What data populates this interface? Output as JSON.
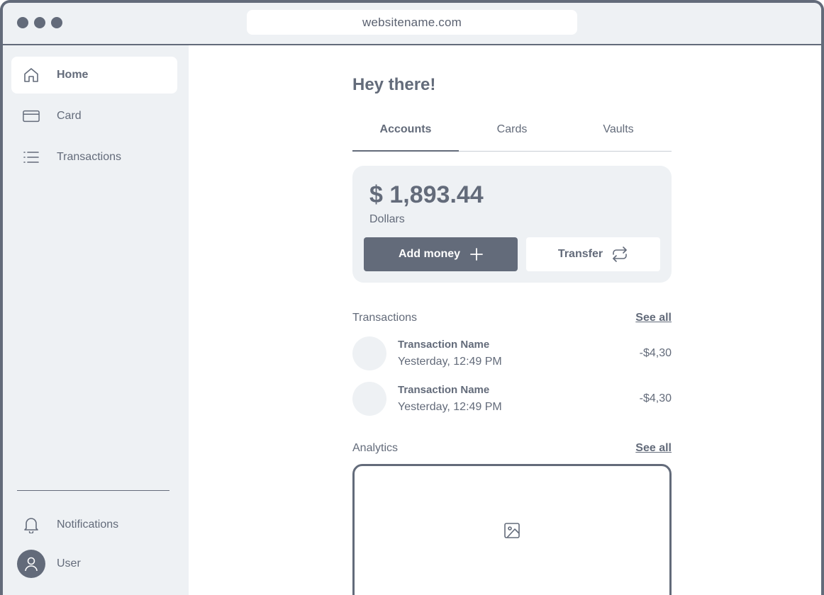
{
  "browser": {
    "url": "websitename.com"
  },
  "sidebar": {
    "items": [
      {
        "label": "Home",
        "icon": "home-icon",
        "active": true
      },
      {
        "label": "Card",
        "icon": "card-icon",
        "active": false
      },
      {
        "label": "Transactions",
        "icon": "list-icon",
        "active": false
      }
    ],
    "bottom": {
      "notifications_label": "Notifications",
      "user_label": "User"
    }
  },
  "main": {
    "greeting": "Hey there!",
    "tabs": [
      {
        "label": "Accounts",
        "active": true
      },
      {
        "label": "Cards",
        "active": false
      },
      {
        "label": "Vaults",
        "active": false
      }
    ],
    "balance": {
      "amount": "$ 1,893.44",
      "currency": "Dollars",
      "add_money_label": "Add money",
      "transfer_label": "Transfer"
    },
    "transactions": {
      "title": "Transactions",
      "see_all": "See all",
      "items": [
        {
          "name": "Transaction Name",
          "time": "Yesterday, 12:49 PM",
          "amount": "-$4,30"
        },
        {
          "name": "Transaction Name",
          "time": "Yesterday, 12:49 PM",
          "amount": "-$4,30"
        }
      ]
    },
    "analytics": {
      "title": "Analytics",
      "see_all": "See all",
      "placeholder_icon": "image-icon"
    }
  },
  "colors": {
    "primary": "#636b7a",
    "surface": "#eef1f4",
    "background": "#ffffff"
  }
}
